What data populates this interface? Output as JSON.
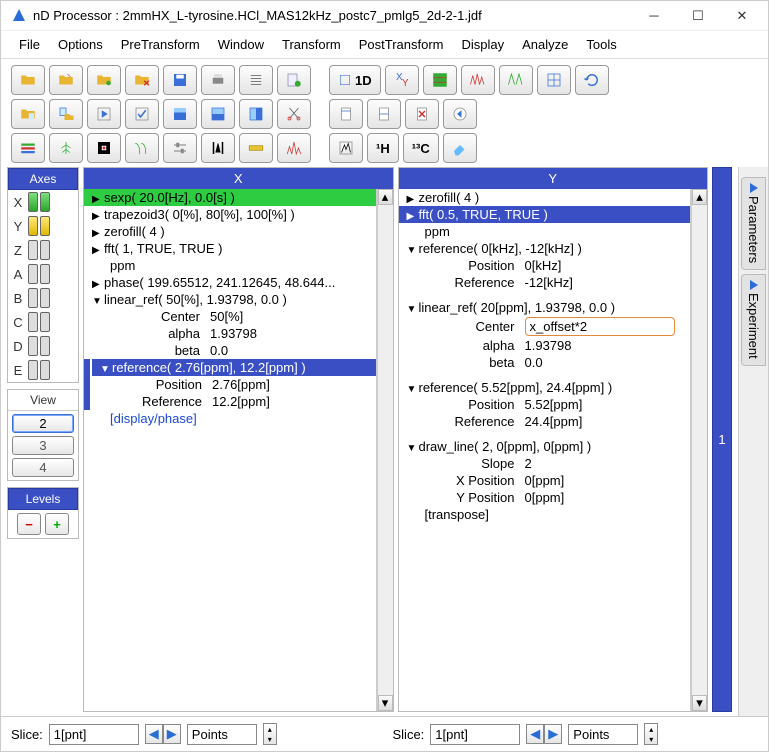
{
  "window": {
    "title": "nD Processor : 2mmHX_L-tyrosine.HCl_MAS12kHz_postc7_pmlg5_2d-2-1.jdf"
  },
  "menu": {
    "file": "File",
    "options": "Options",
    "pretransform": "PreTransform",
    "window": "Window",
    "transform": "Transform",
    "posttransform": "PostTransform",
    "display": "Display",
    "analyze": "Analyze",
    "tools": "Tools"
  },
  "sidebar": {
    "parameters": "Parameters",
    "experiment": "Experiment"
  },
  "axes": {
    "title": "Axes",
    "rows": [
      "X",
      "Y",
      "Z",
      "A",
      "B",
      "C",
      "D",
      "E"
    ],
    "view_title": "View",
    "views": [
      "2",
      "3",
      "4"
    ],
    "levels_title": "Levels"
  },
  "toolbar": {
    "btn_1d": "1D",
    "btn_1h": "¹H",
    "btn_13c": "¹³C"
  },
  "panelX": {
    "title": "X",
    "items": [
      {
        "type": "hl-green",
        "arrow": "r",
        "text": "sexp( 20.0[Hz], 0.0[s] )"
      },
      {
        "type": "",
        "arrow": "r",
        "text": "trapezoid3( 0[%], 80[%], 100[%] )"
      },
      {
        "type": "",
        "arrow": "r",
        "text": "zerofill( 4 )"
      },
      {
        "type": "",
        "arrow": "r",
        "text": "fft( 1, TRUE, TRUE )"
      },
      {
        "type": "",
        "arrow": "",
        "text": "ppm",
        "indent": 1
      },
      {
        "type": "",
        "arrow": "r",
        "text": "phase( 199.65512, 241.12645, 48.644..."
      },
      {
        "type": "",
        "arrow": "d",
        "text": "linear_ref( 50[%], 1.93798, 0.0 )"
      }
    ],
    "linref_params": [
      {
        "label": "Center",
        "val": "50[%]"
      },
      {
        "label": "alpha",
        "val": "1.93798"
      },
      {
        "label": "beta",
        "val": "0.0"
      }
    ],
    "ref_header": "reference( 2.76[ppm], 12.2[ppm] )",
    "ref_params": [
      {
        "label": "Position",
        "val": "2.76[ppm]"
      },
      {
        "label": "Reference",
        "val": "12.2[ppm]"
      }
    ],
    "display_phase": "[display/phase]"
  },
  "panelY": {
    "title": "Y",
    "strip": "1",
    "items": [
      {
        "type": "",
        "arrow": "r",
        "text": "zerofill( 4 )"
      },
      {
        "type": "hl-blue",
        "arrow": "r",
        "text": "fft( 0.5, TRUE, TRUE )"
      },
      {
        "type": "",
        "arrow": "",
        "text": "ppm",
        "indent": 1
      },
      {
        "type": "",
        "arrow": "d",
        "text": "reference( 0[kHz], -12[kHz] )"
      }
    ],
    "ref1_params": [
      {
        "label": "Position",
        "val": "0[kHz]"
      },
      {
        "label": "Reference",
        "val": "-12[kHz]"
      }
    ],
    "linref_header": "linear_ref( 20[ppm], 1.93798, 0.0 )",
    "linref_params": [
      {
        "label": "Center",
        "val": "x_offset*2",
        "input": true
      },
      {
        "label": "alpha",
        "val": "1.93798"
      },
      {
        "label": "beta",
        "val": "0.0"
      }
    ],
    "ref2_header": "reference( 5.52[ppm], 24.4[ppm] )",
    "ref2_params": [
      {
        "label": "Position",
        "val": "5.52[ppm]"
      },
      {
        "label": "Reference",
        "val": "24.4[ppm]"
      }
    ],
    "drawline_header": "draw_line( 2, 0[ppm], 0[ppm] )",
    "drawline_params": [
      {
        "label": "Slope",
        "val": "2"
      },
      {
        "label": "X Position",
        "val": "0[ppm]"
      },
      {
        "label": "Y Position",
        "val": "0[ppm]"
      }
    ],
    "transpose": "[transpose]"
  },
  "footer": {
    "slice_label": "Slice:",
    "slice_value": "1[pnt]",
    "points_label": "Points"
  }
}
